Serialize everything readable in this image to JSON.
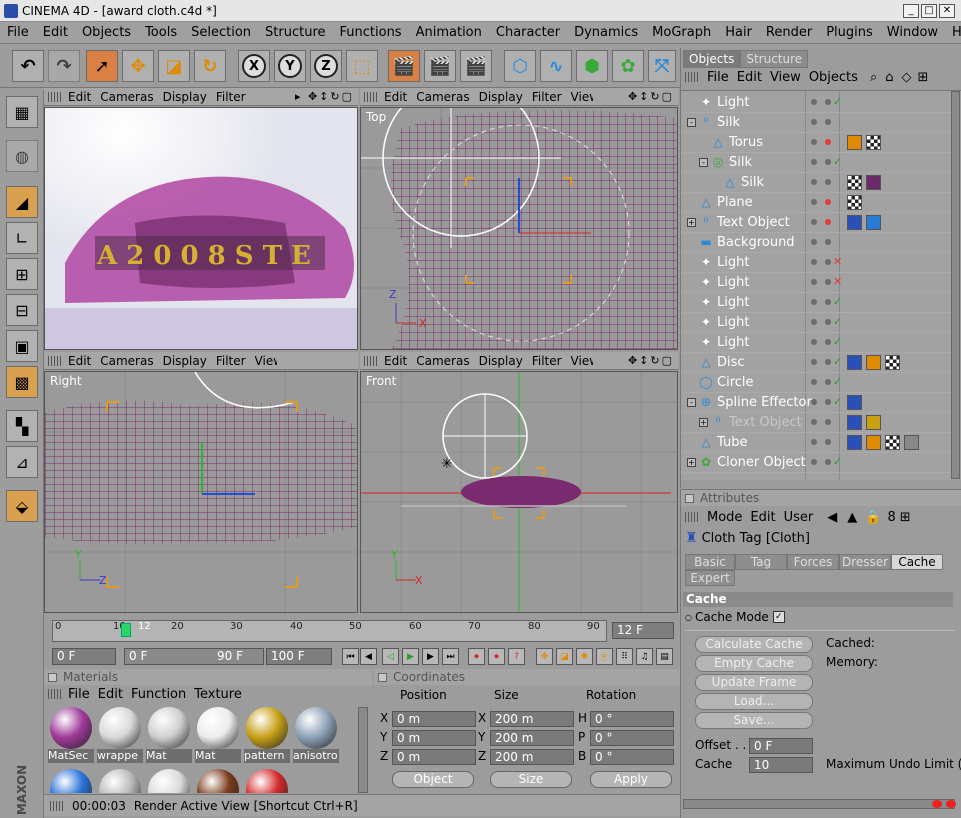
{
  "window": {
    "title": "CINEMA 4D - [award cloth.c4d *]",
    "min": "_",
    "max": "□",
    "close": "✕"
  },
  "menu": [
    "File",
    "Edit",
    "Objects",
    "Tools",
    "Selection",
    "Structure",
    "Functions",
    "Animation",
    "Character",
    "Dynamics",
    "MoGraph",
    "Hair",
    "Render",
    "Plugins",
    "Window",
    "Help"
  ],
  "toolbar": {
    "x": "X",
    "y": "Y",
    "z": "Z"
  },
  "viewport_menu": [
    "Edit",
    "Cameras",
    "Display",
    "Filter",
    "View"
  ],
  "viewports": [
    {
      "label": ""
    },
    {
      "label": "Top"
    },
    {
      "label": "Right"
    },
    {
      "label": "Front"
    }
  ],
  "render_text": "A 2 0 0 8   S T E",
  "axes": {
    "x": "X",
    "y": "Y",
    "z": "Z"
  },
  "timeline": {
    "ticks": [
      "0",
      "10",
      "12",
      "20",
      "30",
      "40",
      "50",
      "60",
      "70",
      "80",
      "90"
    ],
    "current_frame": "12 F",
    "start": "0 F",
    "range_start": "0 F",
    "range_end": "90 F",
    "end": "100 F",
    "playhead_value": 12,
    "max_frame": 100
  },
  "materials": {
    "title": "Materials",
    "menu": [
      "File",
      "Edit",
      "Function",
      "Texture"
    ],
    "items": [
      {
        "name": "MatSec",
        "color": "#a03a9a"
      },
      {
        "name": "wrappe",
        "color": "#d8d8d8"
      },
      {
        "name": "Mat",
        "color": "#cfcfcf"
      },
      {
        "name": "Mat",
        "color": "#ececec"
      },
      {
        "name": "pattern",
        "color": "#c7a016"
      },
      {
        "name": "anisotro",
        "color": "#8fa3b8"
      }
    ],
    "row2_colors": [
      "#2a72d8",
      "#b9b9b9",
      "#dadada",
      "#7a3a1a",
      "#d42a2a"
    ]
  },
  "coordinates": {
    "title": "Coordinates",
    "headers": [
      "Position",
      "Size",
      "Rotation"
    ],
    "rows": [
      {
        "axis": "X",
        "pos": "0 m",
        "saxis": "X",
        "size": "200 m",
        "raxis": "H",
        "rot": "0 °"
      },
      {
        "axis": "Y",
        "pos": "0 m",
        "saxis": "Y",
        "size": "200 m",
        "raxis": "P",
        "rot": "0 °"
      },
      {
        "axis": "Z",
        "pos": "0 m",
        "saxis": "Z",
        "size": "200 m",
        "raxis": "B",
        "rot": "0 °"
      }
    ],
    "mode": "Object",
    "size_mode": "Size",
    "apply": "Apply"
  },
  "status": {
    "time": "00:00:03",
    "message": "Render Active View [Shortcut Ctrl+R]"
  },
  "objects_panel": {
    "tabs": [
      "Objects",
      "Structure"
    ],
    "menu": [
      "File",
      "Edit",
      "View",
      "Objects"
    ],
    "items": [
      {
        "name": "Light",
        "icon": "light-icon",
        "depth": 0,
        "expand": "",
        "state": "check"
      },
      {
        "name": "Silk",
        "icon": "null-icon",
        "depth": 0,
        "expand": "-",
        "state": ""
      },
      {
        "name": "Torus",
        "icon": "torus-icon",
        "depth": 1,
        "expand": "",
        "state": "red"
      },
      {
        "name": "Silk",
        "icon": "cloth-icon",
        "depth": 1,
        "expand": "-",
        "state": "check"
      },
      {
        "name": "Silk",
        "icon": "polygon-icon",
        "depth": 2,
        "expand": "",
        "state": ""
      },
      {
        "name": "Plane",
        "icon": "polygon-icon",
        "depth": 0,
        "expand": "",
        "state": "red"
      },
      {
        "name": "Text Object",
        "icon": "null-icon",
        "depth": 0,
        "expand": "+",
        "state": "red"
      },
      {
        "name": "Background",
        "icon": "background-icon",
        "depth": 0,
        "expand": "",
        "state": ""
      },
      {
        "name": "Light",
        "icon": "light-icon",
        "depth": 0,
        "expand": "",
        "state": "x"
      },
      {
        "name": "Light",
        "icon": "light-icon",
        "depth": 0,
        "expand": "",
        "state": "x"
      },
      {
        "name": "Light",
        "icon": "light-icon",
        "depth": 0,
        "expand": "",
        "state": "check"
      },
      {
        "name": "Light",
        "icon": "light-icon",
        "depth": 0,
        "expand": "",
        "state": "check"
      },
      {
        "name": "Light",
        "icon": "light-icon",
        "depth": 0,
        "expand": "",
        "state": "check"
      },
      {
        "name": "Disc",
        "icon": "polygon-icon",
        "depth": 0,
        "expand": "",
        "state": "check"
      },
      {
        "name": "Circle",
        "icon": "spline-icon",
        "depth": 0,
        "expand": "",
        "state": "check"
      },
      {
        "name": "Spline Effector",
        "icon": "effector-icon",
        "depth": 0,
        "expand": "-",
        "state": "check"
      },
      {
        "name": "Text Object",
        "icon": "null-icon",
        "depth": 1,
        "expand": "+",
        "state": "",
        "dim": true
      },
      {
        "name": "Tube",
        "icon": "polygon-icon",
        "depth": 0,
        "expand": "",
        "state": ""
      },
      {
        "name": "Cloner Object",
        "icon": "cloner-icon",
        "depth": 0,
        "expand": "+",
        "state": "check"
      }
    ]
  },
  "attributes": {
    "title": "Attributes",
    "menu": [
      "Mode",
      "Edit",
      "User"
    ],
    "object": "Cloth Tag [Cloth]",
    "tabs": [
      "Basic",
      "Tag",
      "Forces",
      "Dresser",
      "Cache",
      "Expert"
    ],
    "section": "Cache",
    "cache_mode_label": "Cache Mode",
    "buttons": [
      "Calculate Cache",
      "Empty Cache",
      "Update Frame",
      "Load...",
      "Save..."
    ],
    "cached_label": "Cached:",
    "memory_label": "Memory:",
    "offset_label": "Offset . .",
    "offset_value": "0 F",
    "cache_label": "Cache",
    "cache_value": "10",
    "undo_label": "Maximum Undo Limit ("
  }
}
